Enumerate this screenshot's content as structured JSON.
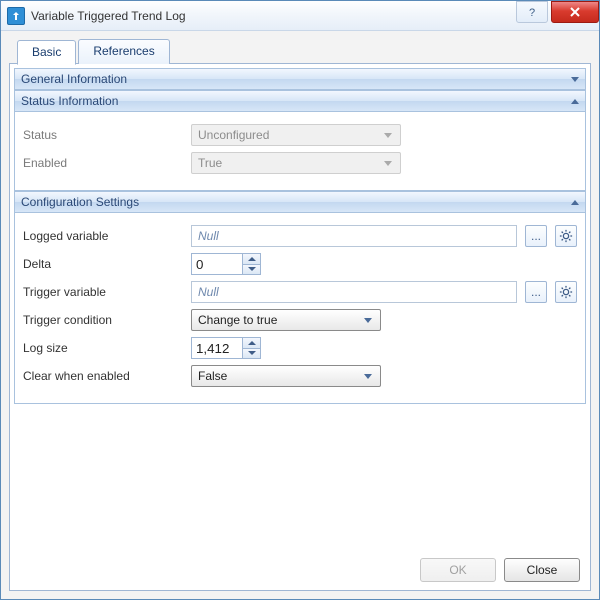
{
  "window": {
    "title": "Variable Triggered Trend Log"
  },
  "tabs": {
    "basic": "Basic",
    "references": "References",
    "active": "basic"
  },
  "sections": {
    "general": {
      "title": "General Information",
      "expanded": false
    },
    "status": {
      "title": "Status Information",
      "expanded": true
    },
    "config": {
      "title": "Configuration Settings",
      "expanded": true
    }
  },
  "status": {
    "status_label": "Status",
    "status_value": "Unconfigured",
    "enabled_label": "Enabled",
    "enabled_value": "True"
  },
  "config": {
    "logged_variable_label": "Logged variable",
    "logged_variable_value": "Null",
    "delta_label": "Delta",
    "delta_value": "0",
    "trigger_variable_label": "Trigger variable",
    "trigger_variable_value": "Null",
    "trigger_condition_label": "Trigger condition",
    "trigger_condition_value": "Change to true",
    "log_size_label": "Log size",
    "log_size_value": "1,412",
    "clear_when_enabled_label": "Clear when enabled",
    "clear_when_enabled_value": "False"
  },
  "buttons": {
    "ok": "OK",
    "close": "Close",
    "ellipsis": "..."
  }
}
